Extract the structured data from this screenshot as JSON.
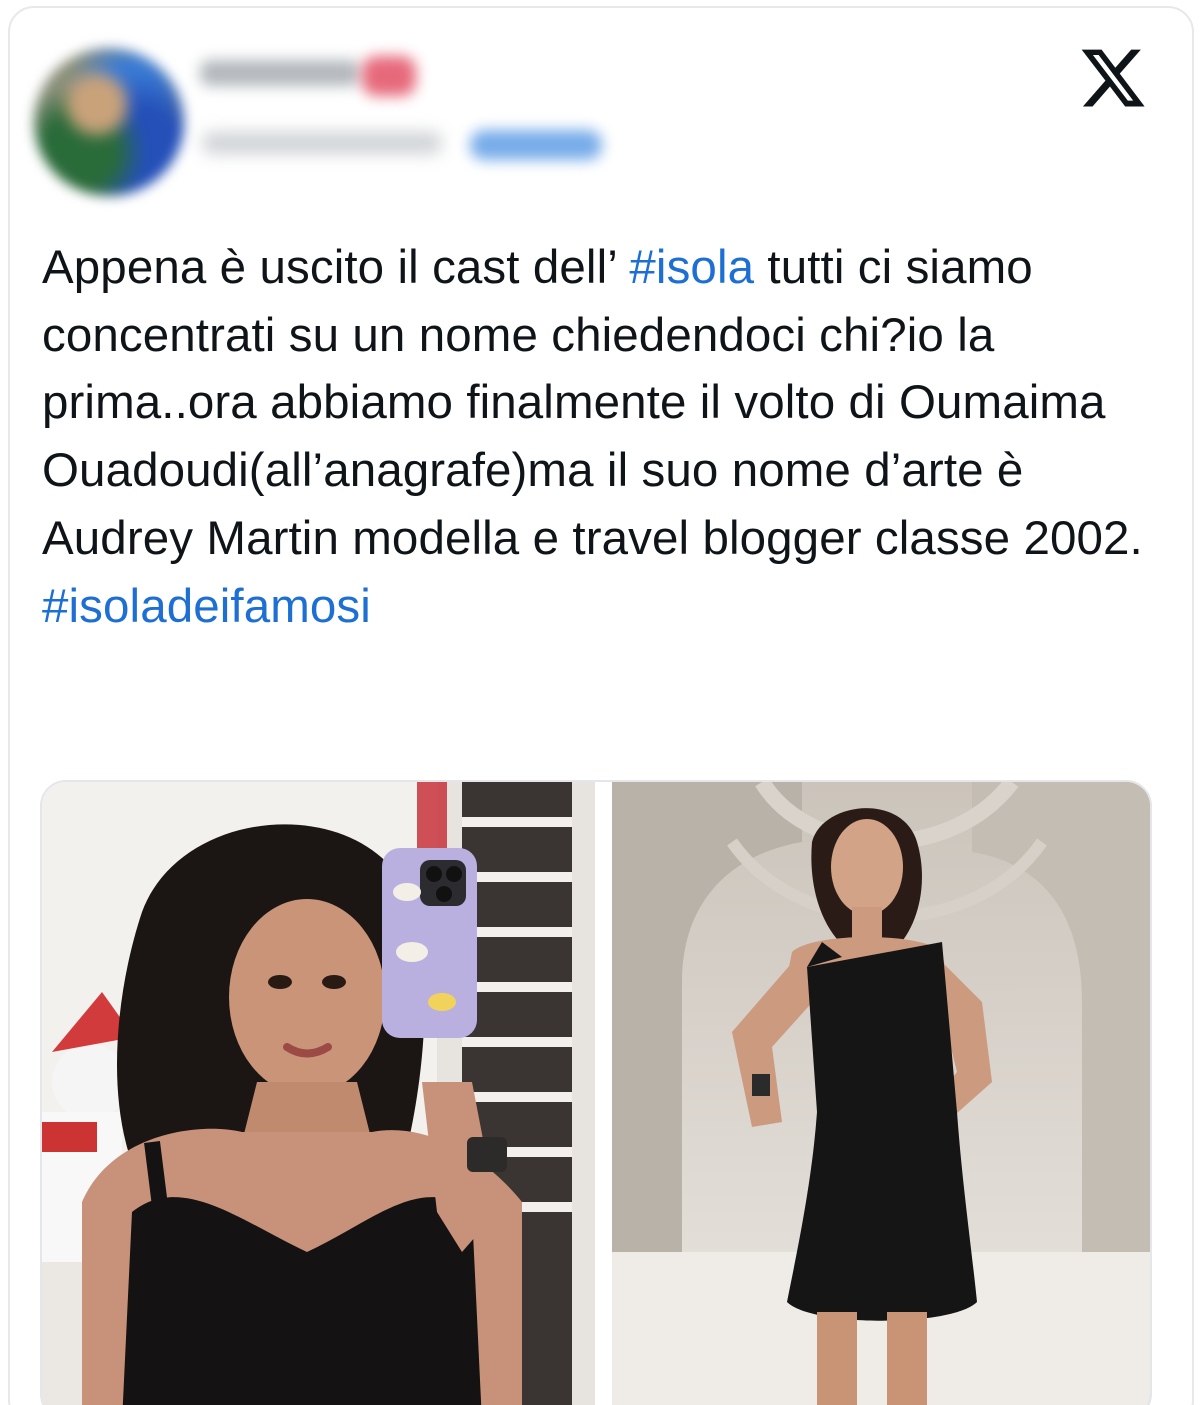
{
  "tweet": {
    "text_parts": [
      "Appena è uscito il cast dell’ ",
      "#isola",
      " tutti ci siamo concentrati su un nome chiedendoci chi?io la prima..ora abbiamo finalmente il volto di Oumaima Ouadoudi(all’anagrafe)ma il suo nome d’arte è Audrey Martin modella e travel blogger classe 2002. ",
      "#isoladeifamosi"
    ]
  },
  "icons": {
    "platform_logo": "x-logo-icon"
  },
  "colors": {
    "hashtag": "#1d6fd3",
    "text": "#0f1419",
    "border": "#e6e8eb"
  }
}
